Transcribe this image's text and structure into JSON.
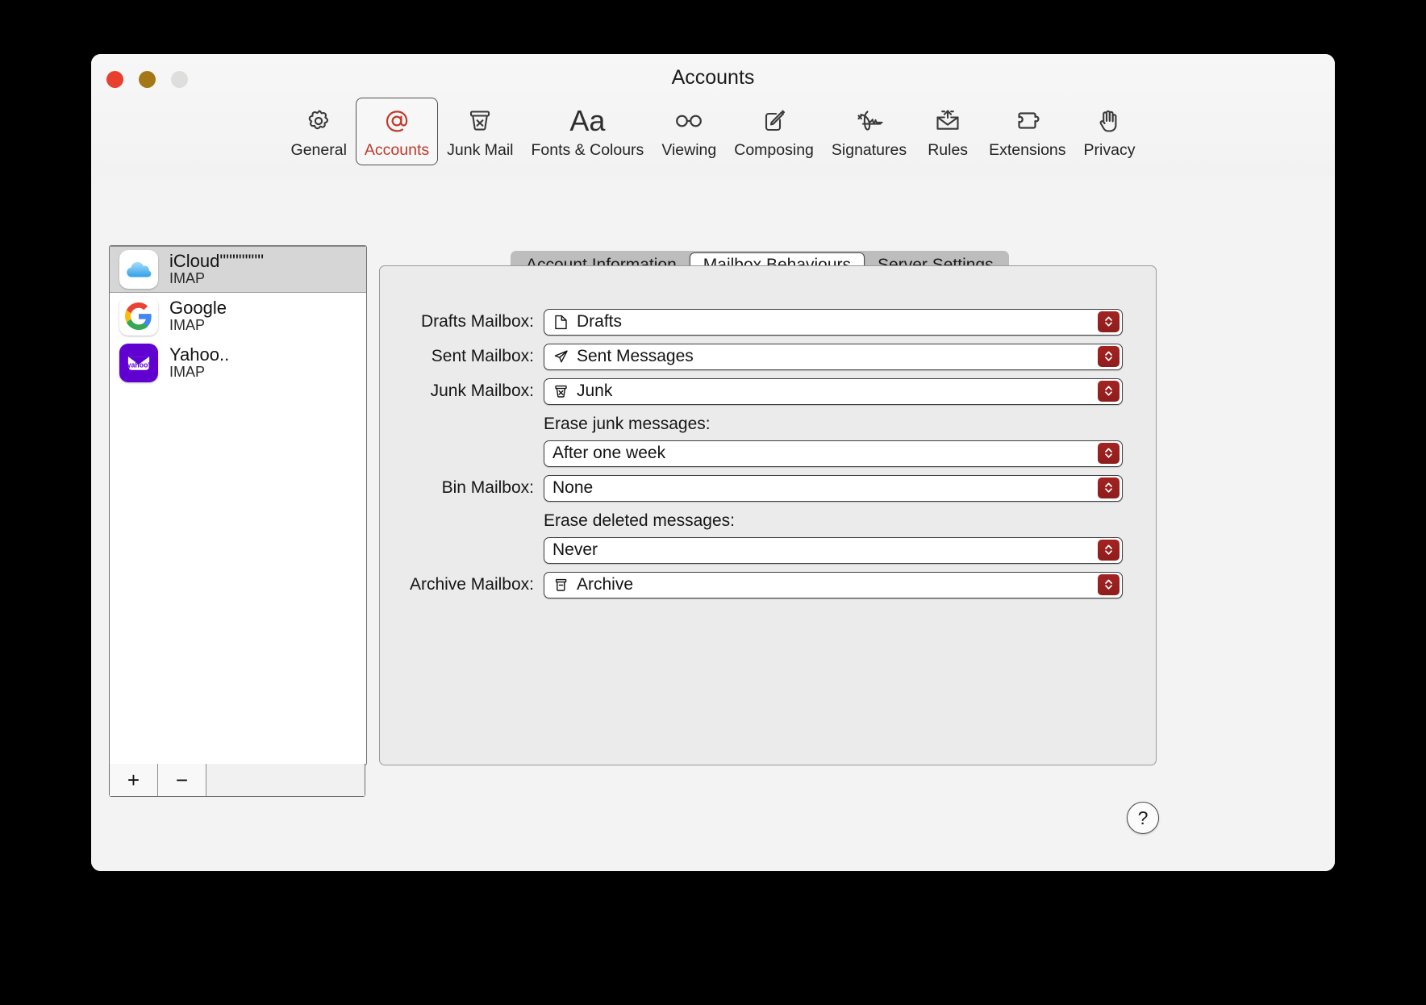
{
  "window": {
    "title": "Accounts",
    "traffic_lights": [
      "close",
      "minimise",
      "zoom"
    ]
  },
  "toolbar": {
    "items": [
      {
        "label": "General",
        "icon": "gear-icon",
        "selected": false
      },
      {
        "label": "Accounts",
        "icon": "at-sign-icon",
        "selected": true
      },
      {
        "label": "Junk Mail",
        "icon": "junk-bin-icon",
        "selected": false
      },
      {
        "label": "Fonts & Colours",
        "icon": "aa-text-icon",
        "selected": false
      },
      {
        "label": "Viewing",
        "icon": "glasses-icon",
        "selected": false
      },
      {
        "label": "Composing",
        "icon": "compose-icon",
        "selected": false
      },
      {
        "label": "Signatures",
        "icon": "signature-icon",
        "selected": false
      },
      {
        "label": "Rules",
        "icon": "rules-mail-icon",
        "selected": false
      },
      {
        "label": "Extensions",
        "icon": "puzzle-icon",
        "selected": false
      },
      {
        "label": "Privacy",
        "icon": "hand-icon",
        "selected": false
      }
    ],
    "accent_color": "#c0392b"
  },
  "sidebar": {
    "accounts": [
      {
        "name": "iCloud\"\"\"\"\"\"\"",
        "type": "IMAP",
        "icon": "icloud-icon",
        "selected": true
      },
      {
        "name": "Google",
        "type": "IMAP",
        "icon": "google-icon",
        "selected": false
      },
      {
        "name": "Yahoo..",
        "type": "IMAP",
        "icon": "yahoo-icon",
        "selected": false
      }
    ],
    "footer": {
      "add_label": "+",
      "remove_label": "−"
    }
  },
  "tabs": [
    {
      "label": "Account Information",
      "active": false
    },
    {
      "label": "Mailbox Behaviours",
      "active": true
    },
    {
      "label": "Server Settings",
      "active": false
    }
  ],
  "form": {
    "rows": [
      {
        "label": "Drafts Mailbox:",
        "value": "Drafts",
        "icon": "document-icon"
      },
      {
        "label": "Sent Mailbox:",
        "value": "Sent Messages",
        "icon": "paper-plane-icon"
      },
      {
        "label": "Junk Mailbox:",
        "value": "Junk",
        "icon": "junk-bin-icon"
      }
    ],
    "erase_junk_label": "Erase junk messages:",
    "erase_junk_value": "After one week",
    "bin_label": "Bin Mailbox:",
    "bin_value": "None",
    "erase_deleted_label": "Erase deleted messages:",
    "erase_deleted_value": "Never",
    "archive_label": "Archive Mailbox:",
    "archive_value": "Archive",
    "archive_icon": "archive-box-icon",
    "stepper_color": "#a32321"
  },
  "help": {
    "label": "?"
  }
}
